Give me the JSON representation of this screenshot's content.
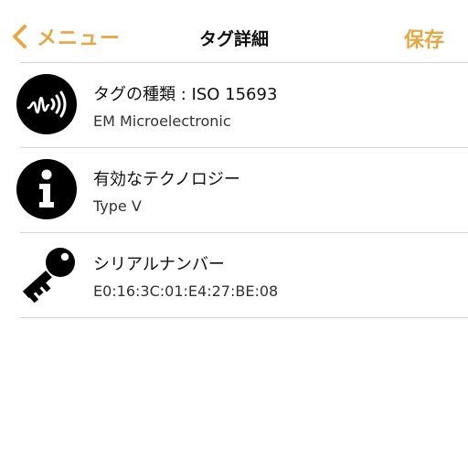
{
  "nav": {
    "back_label": "メニュー",
    "title": "タグ詳細",
    "save_label": "保存",
    "accent_color": "#E6A843"
  },
  "rows": [
    {
      "icon": "nfc-wave-icon",
      "title": "タグの種類 : ISO 15693",
      "value": "EM Microelectronic"
    },
    {
      "icon": "info-icon",
      "title": "有効なテクノロジー",
      "value": "Type V"
    },
    {
      "icon": "key-icon",
      "title": "シリアルナンバー",
      "value": "E0:16:3C:01:E4:27:BE:08"
    }
  ]
}
